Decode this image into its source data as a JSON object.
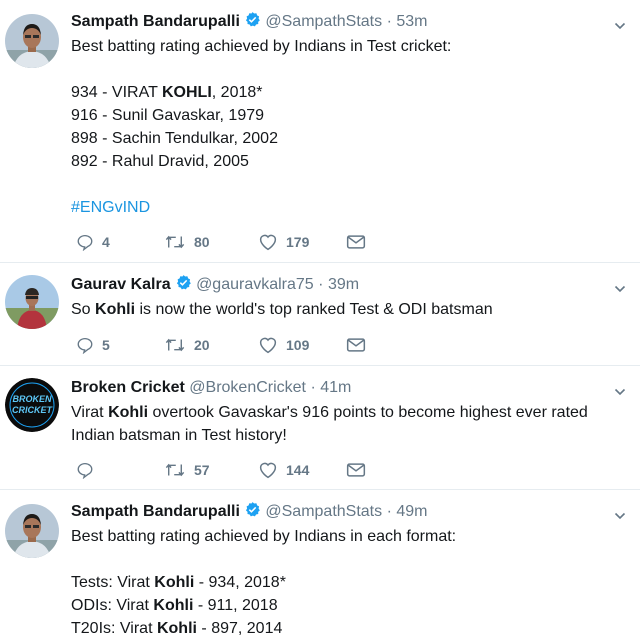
{
  "tweets": [
    {
      "name": "Sampath Bandarupalli",
      "verified": true,
      "handle": "@SampathStats",
      "time": "53m",
      "lines": [
        {
          "segments": [
            {
              "t": "Best batting rating achieved by Indians in Test cricket:"
            }
          ]
        },
        {
          "segments": []
        },
        {
          "segments": [
            {
              "t": "934 - VIRAT "
            },
            {
              "t": "KOHLI",
              "b": true
            },
            {
              "t": ", 2018*"
            }
          ]
        },
        {
          "segments": [
            {
              "t": "916 - Sunil Gavaskar, 1979"
            }
          ]
        },
        {
          "segments": [
            {
              "t": "898 - Sachin Tendulkar, 2002"
            }
          ]
        },
        {
          "segments": [
            {
              "t": "892 - Rahul Dravid, 2005"
            }
          ]
        },
        {
          "segments": []
        },
        {
          "segments": [
            {
              "t": "#ENGvIND",
              "h": true
            }
          ]
        }
      ],
      "replies": "4",
      "retweets": "80",
      "likes": "179"
    },
    {
      "name": "Gaurav Kalra",
      "verified": true,
      "handle": "@gauravkalra75",
      "time": "39m",
      "lines": [
        {
          "segments": [
            {
              "t": "So "
            },
            {
              "t": "Kohli",
              "b": true
            },
            {
              "t": " is now the world's top ranked Test & ODI batsman"
            }
          ]
        }
      ],
      "replies": "5",
      "retweets": "20",
      "likes": "109"
    },
    {
      "name": "Broken Cricket",
      "verified": false,
      "handle": "@BrokenCricket",
      "time": "41m",
      "avatar_text": [
        "BROKEN",
        "CRICKET"
      ],
      "lines": [
        {
          "segments": [
            {
              "t": "Virat "
            },
            {
              "t": "Kohli",
              "b": true
            },
            {
              "t": " overtook Gavaskar's 916 points to become highest ever rated Indian batsman in Test history!"
            }
          ],
          "wrap": true
        }
      ],
      "replies": "",
      "retweets": "57",
      "likes": "144"
    },
    {
      "name": "Sampath Bandarupalli",
      "verified": true,
      "handle": "@SampathStats",
      "time": "49m",
      "lines": [
        {
          "segments": [
            {
              "t": "Best batting rating achieved by Indians in each format:"
            }
          ]
        },
        {
          "segments": []
        },
        {
          "segments": [
            {
              "t": "Tests: Virat "
            },
            {
              "t": "Kohli",
              "b": true
            },
            {
              "t": " - 934, 2018*"
            }
          ]
        },
        {
          "segments": [
            {
              "t": "ODIs: Virat "
            },
            {
              "t": "Kohli",
              "b": true
            },
            {
              "t": " - 911, 2018"
            }
          ]
        },
        {
          "segments": [
            {
              "t": "T20Is: Virat "
            },
            {
              "t": "Kohli",
              "b": true
            },
            {
              "t": " - 897, 2014"
            }
          ]
        }
      ]
    }
  ],
  "colors": {
    "text": "#14171a",
    "secondary": "#657786",
    "link": "#1b95e0",
    "verified": "#1da1f2",
    "divider": "#e6ecf0"
  },
  "icons": [
    "verified-badge-icon",
    "chevron-down-icon",
    "reply-icon",
    "retweet-icon",
    "like-icon",
    "direct-message-icon"
  ]
}
